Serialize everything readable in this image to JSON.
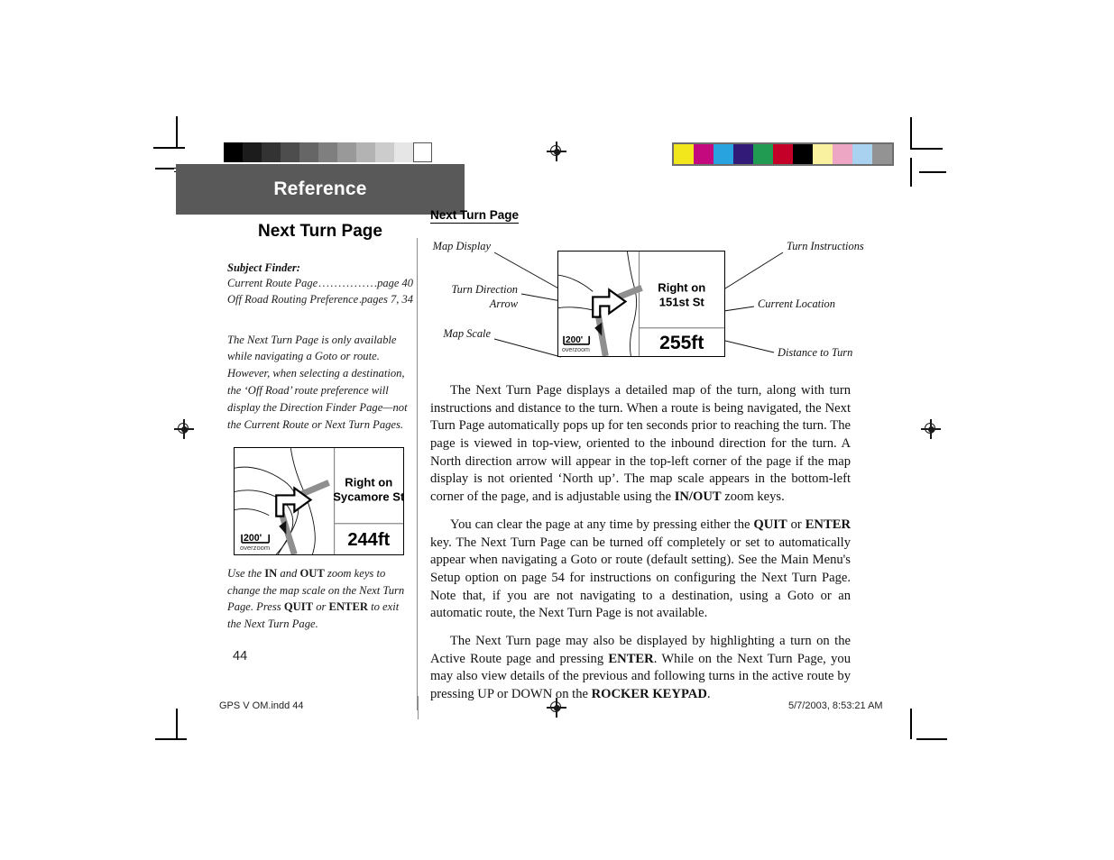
{
  "document": {
    "section_band_label": "Reference",
    "page_number": "44",
    "band_color": "#595959"
  },
  "left_column": {
    "title": "Next Turn Page",
    "subject_finder_heading": "Subject Finder:",
    "subject_finder_entries": [
      {
        "topic": "Current Route Page",
        "page": "page 40"
      },
      {
        "topic": "Off Road Routing Preference",
        "page": "pages 7, 34"
      }
    ],
    "side_note": "The Next Turn Page is only available while navigating a Goto or route. However, when selecting a destination, the ‘Off Road’ route preference will display the Direction Finder Page—not the Current Route or Next Turn Pages.",
    "figure_caption_parts": [
      {
        "text": "Use the ",
        "bold": false
      },
      {
        "text": "IN",
        "bold": true
      },
      {
        "text": " and ",
        "bold": false
      },
      {
        "text": "OUT",
        "bold": true
      },
      {
        "text": " zoom keys to change the map scale on the Next Turn Page. Press ",
        "bold": false
      },
      {
        "text": "QUIT",
        "bold": true
      },
      {
        "text": " or ",
        "bold": false
      },
      {
        "text": "ENTER",
        "bold": true
      },
      {
        "text": " to exit the Next Turn Page.",
        "bold": false
      }
    ]
  },
  "gps_screens": {
    "left_figure": {
      "turn_instruction_line1": "Right on",
      "turn_instruction_line2": "Sycamore St",
      "distance": "244ft",
      "map_scale": "200'",
      "map_scale_note": "overzoom"
    },
    "right_figure": {
      "turn_instruction_line1": "Right on",
      "turn_instruction_line2": "151st St",
      "distance": "255ft",
      "map_scale": "200'",
      "map_scale_note": "overzoom"
    }
  },
  "diagram": {
    "callouts": [
      {
        "label": "Map Display"
      },
      {
        "label": "Turn Direction",
        "label2": "Arrow"
      },
      {
        "label": "Map Scale"
      },
      {
        "label": "Turn Instructions"
      },
      {
        "label": "Current Location"
      },
      {
        "label": "Distance to Turn"
      }
    ]
  },
  "right_column": {
    "heading": "Next Turn Page",
    "paragraphs": [
      {
        "indent": true,
        "runs": [
          {
            "text": "The Next Turn Page displays a detailed map of the turn, along with turn instructions and distance to the turn.  When a route is being navigated, the Next Turn Page automatically pops up for ten seconds prior to reaching the turn. The page is viewed in top-view, oriented to the inbound direction for the turn.  A North direction arrow will appear in the top-left corner of the page if the map display is not oriented ‘North up’. The map scale appears in the bottom-left corner of the page, and is adjustable using the ",
            "bold": false
          },
          {
            "text": "IN/OUT",
            "bold": true
          },
          {
            "text": " zoom keys.",
            "bold": false
          }
        ]
      },
      {
        "indent": true,
        "runs": [
          {
            "text": "You can clear the page at any time by pressing either the ",
            "bold": false
          },
          {
            "text": "QUIT",
            "bold": true
          },
          {
            "text": " or ",
            "bold": false
          },
          {
            "text": "ENTER",
            "bold": true
          },
          {
            "text": " key. The Next Turn Page can be turned off completely or set to automatically appear when navigating a Goto or route (default setting).  See the Main Menu's Setup option on page 54 for instructions on configuring the Next Turn Page.  Note that, if you are not navigating to a destination, using a Goto or an automatic route, the Next Turn Page is not available.",
            "bold": false
          }
        ]
      },
      {
        "indent": true,
        "runs": [
          {
            "text": "The Next Turn page may also be displayed by highlighting a turn on the Active Route page and pressing ",
            "bold": false
          },
          {
            "text": "ENTER",
            "bold": true
          },
          {
            "text": ".  While on the Next Turn Page, you may also view details of the previous and following turns in the active route by pressing UP or DOWN on the ",
            "bold": false
          },
          {
            "text": "ROCKER KEYPAD",
            "bold": true
          },
          {
            "text": ".",
            "bold": false
          }
        ]
      }
    ]
  },
  "footer": {
    "file_label": "GPS V OM.indd   44",
    "timestamp": "5/7/2003, 8:53:21 AM"
  },
  "print_marks": {
    "gray_swatches": [
      "#000000",
      "#1c1c1c",
      "#333333",
      "#4d4d4d",
      "#666666",
      "#7f7f7f",
      "#999999",
      "#b3b3b3",
      "#cccccc",
      "#e6e6e6",
      "#ffffff"
    ],
    "color_swatches": [
      "#f2e61c",
      "#c4097e",
      "#29a3e0",
      "#321a78",
      "#219a52",
      "#c40029",
      "#000000",
      "#f9f0a0",
      "#eda6c4",
      "#a8d2f0",
      "#939393"
    ]
  }
}
